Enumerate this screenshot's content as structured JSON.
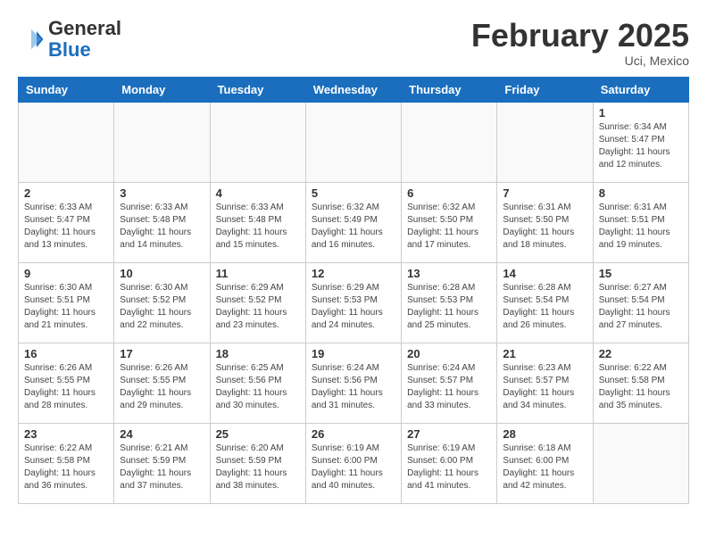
{
  "header": {
    "logo_general": "General",
    "logo_blue": "Blue",
    "month_year": "February 2025",
    "location": "Uci, Mexico"
  },
  "days_of_week": [
    "Sunday",
    "Monday",
    "Tuesday",
    "Wednesday",
    "Thursday",
    "Friday",
    "Saturday"
  ],
  "weeks": [
    [
      {
        "day": "",
        "info": ""
      },
      {
        "day": "",
        "info": ""
      },
      {
        "day": "",
        "info": ""
      },
      {
        "day": "",
        "info": ""
      },
      {
        "day": "",
        "info": ""
      },
      {
        "day": "",
        "info": ""
      },
      {
        "day": "1",
        "info": "Sunrise: 6:34 AM\nSunset: 5:47 PM\nDaylight: 11 hours and 12 minutes."
      }
    ],
    [
      {
        "day": "2",
        "info": "Sunrise: 6:33 AM\nSunset: 5:47 PM\nDaylight: 11 hours and 13 minutes."
      },
      {
        "day": "3",
        "info": "Sunrise: 6:33 AM\nSunset: 5:48 PM\nDaylight: 11 hours and 14 minutes."
      },
      {
        "day": "4",
        "info": "Sunrise: 6:33 AM\nSunset: 5:48 PM\nDaylight: 11 hours and 15 minutes."
      },
      {
        "day": "5",
        "info": "Sunrise: 6:32 AM\nSunset: 5:49 PM\nDaylight: 11 hours and 16 minutes."
      },
      {
        "day": "6",
        "info": "Sunrise: 6:32 AM\nSunset: 5:50 PM\nDaylight: 11 hours and 17 minutes."
      },
      {
        "day": "7",
        "info": "Sunrise: 6:31 AM\nSunset: 5:50 PM\nDaylight: 11 hours and 18 minutes."
      },
      {
        "day": "8",
        "info": "Sunrise: 6:31 AM\nSunset: 5:51 PM\nDaylight: 11 hours and 19 minutes."
      }
    ],
    [
      {
        "day": "9",
        "info": "Sunrise: 6:30 AM\nSunset: 5:51 PM\nDaylight: 11 hours and 21 minutes."
      },
      {
        "day": "10",
        "info": "Sunrise: 6:30 AM\nSunset: 5:52 PM\nDaylight: 11 hours and 22 minutes."
      },
      {
        "day": "11",
        "info": "Sunrise: 6:29 AM\nSunset: 5:52 PM\nDaylight: 11 hours and 23 minutes."
      },
      {
        "day": "12",
        "info": "Sunrise: 6:29 AM\nSunset: 5:53 PM\nDaylight: 11 hours and 24 minutes."
      },
      {
        "day": "13",
        "info": "Sunrise: 6:28 AM\nSunset: 5:53 PM\nDaylight: 11 hours and 25 minutes."
      },
      {
        "day": "14",
        "info": "Sunrise: 6:28 AM\nSunset: 5:54 PM\nDaylight: 11 hours and 26 minutes."
      },
      {
        "day": "15",
        "info": "Sunrise: 6:27 AM\nSunset: 5:54 PM\nDaylight: 11 hours and 27 minutes."
      }
    ],
    [
      {
        "day": "16",
        "info": "Sunrise: 6:26 AM\nSunset: 5:55 PM\nDaylight: 11 hours and 28 minutes."
      },
      {
        "day": "17",
        "info": "Sunrise: 6:26 AM\nSunset: 5:55 PM\nDaylight: 11 hours and 29 minutes."
      },
      {
        "day": "18",
        "info": "Sunrise: 6:25 AM\nSunset: 5:56 PM\nDaylight: 11 hours and 30 minutes."
      },
      {
        "day": "19",
        "info": "Sunrise: 6:24 AM\nSunset: 5:56 PM\nDaylight: 11 hours and 31 minutes."
      },
      {
        "day": "20",
        "info": "Sunrise: 6:24 AM\nSunset: 5:57 PM\nDaylight: 11 hours and 33 minutes."
      },
      {
        "day": "21",
        "info": "Sunrise: 6:23 AM\nSunset: 5:57 PM\nDaylight: 11 hours and 34 minutes."
      },
      {
        "day": "22",
        "info": "Sunrise: 6:22 AM\nSunset: 5:58 PM\nDaylight: 11 hours and 35 minutes."
      }
    ],
    [
      {
        "day": "23",
        "info": "Sunrise: 6:22 AM\nSunset: 5:58 PM\nDaylight: 11 hours and 36 minutes."
      },
      {
        "day": "24",
        "info": "Sunrise: 6:21 AM\nSunset: 5:59 PM\nDaylight: 11 hours and 37 minutes."
      },
      {
        "day": "25",
        "info": "Sunrise: 6:20 AM\nSunset: 5:59 PM\nDaylight: 11 hours and 38 minutes."
      },
      {
        "day": "26",
        "info": "Sunrise: 6:19 AM\nSunset: 6:00 PM\nDaylight: 11 hours and 40 minutes."
      },
      {
        "day": "27",
        "info": "Sunrise: 6:19 AM\nSunset: 6:00 PM\nDaylight: 11 hours and 41 minutes."
      },
      {
        "day": "28",
        "info": "Sunrise: 6:18 AM\nSunset: 6:00 PM\nDaylight: 11 hours and 42 minutes."
      },
      {
        "day": "",
        "info": ""
      }
    ]
  ]
}
